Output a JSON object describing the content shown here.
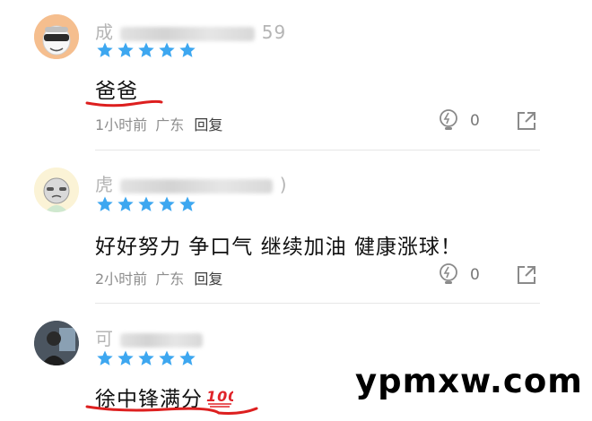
{
  "colors": {
    "star": "#3da7f0",
    "underline": "#dd1f1f",
    "meta": "#8e8e8e",
    "reply": "#3d3d3d"
  },
  "comments": [
    {
      "username_visible_start": "成",
      "username_visible_end": "59",
      "username_middle": "ID1883476",
      "rating": 5,
      "text": "爸爸",
      "time": "1小时前",
      "location": "广东",
      "reply_label": "回复",
      "likes": "0"
    },
    {
      "username_visible_start": "虎",
      "username_visible_end": ")",
      "rating": 5,
      "text": "好好努力 争口气 继续加油 健康涨球！",
      "time": "2小时前",
      "location": "广东",
      "reply_label": "回复",
      "likes": "0"
    },
    {
      "username_visible_start": "可",
      "rating": 5,
      "text": "徐中锋满分",
      "emoji": "💯"
    }
  ],
  "watermark": "ypmxw.com"
}
